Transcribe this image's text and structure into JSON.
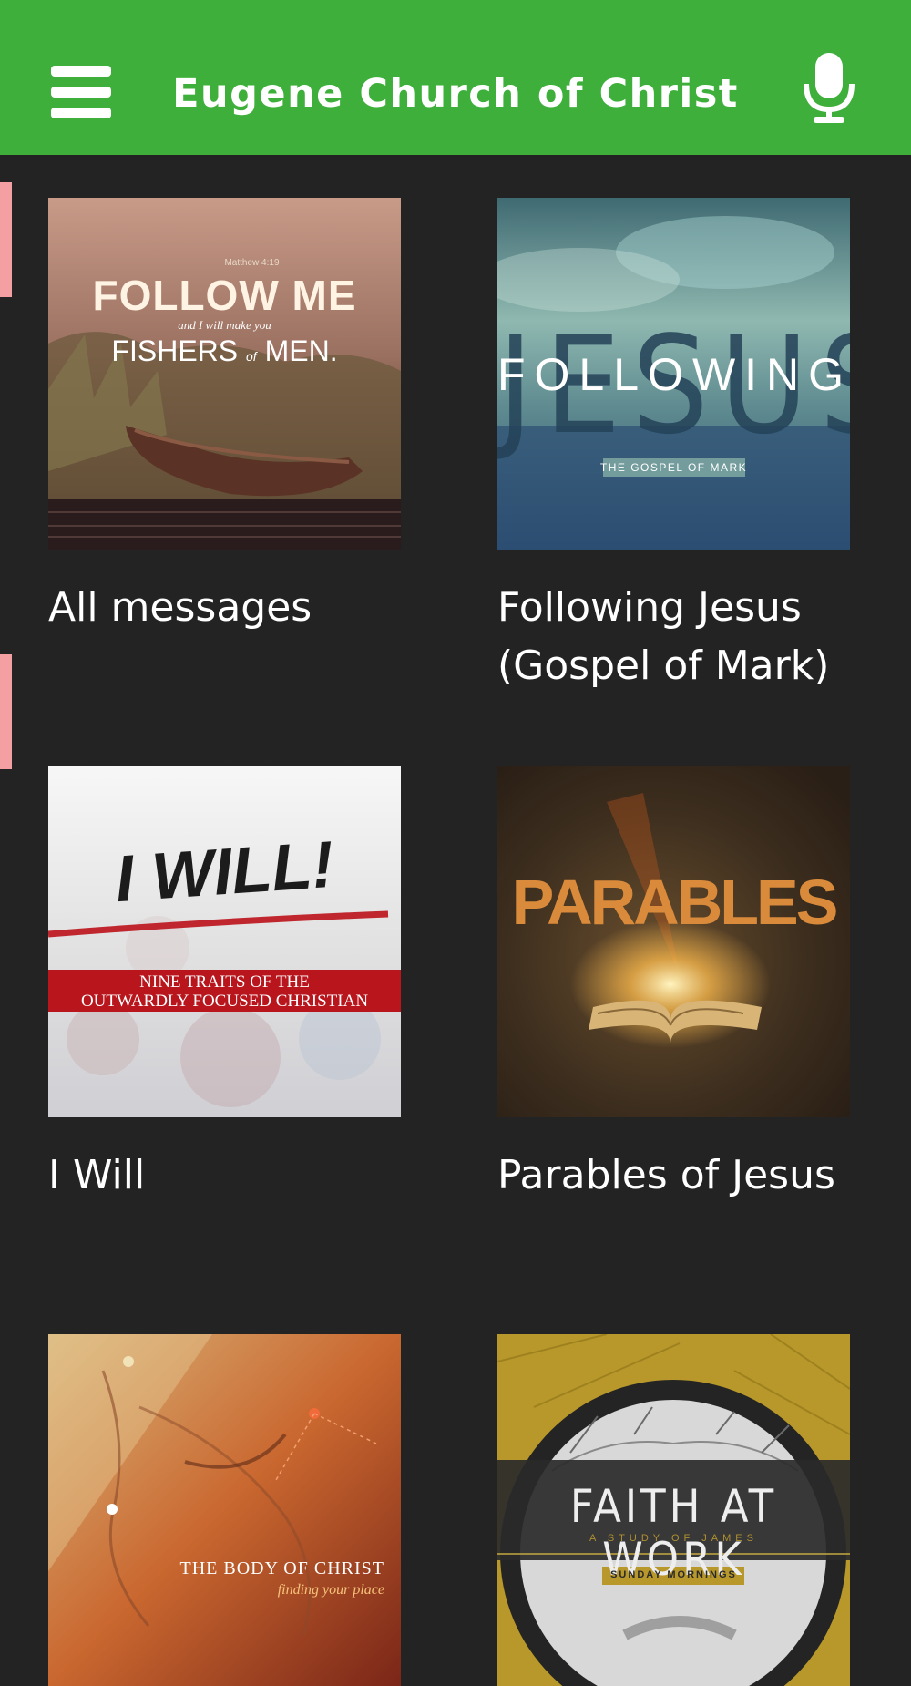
{
  "app": {
    "title": "Eugene Church of Christ",
    "accent_color": "#3daf3a",
    "background_color": "#232323"
  },
  "header": {
    "menu_icon": "hamburger-menu-icon",
    "mic_icon": "microphone-icon"
  },
  "series": [
    {
      "label": "All messages",
      "art": {
        "ref": "Matthew 4:19",
        "headline": "FOLLOW ME",
        "line2": "and I will make you",
        "line3a": "FISHERS",
        "line3b": "of",
        "line3c": "MEN."
      }
    },
    {
      "label": "Following Jesus (Gospel of Mark)",
      "art": {
        "big": "JESUS",
        "overlay": "FOLLOWING",
        "sub": "THE GOSPEL OF MARK"
      }
    },
    {
      "label": "I Will",
      "art": {
        "headline": "I WILL!",
        "band1": "NINE TRAITS OF THE",
        "band2": "OUTWARDLY FOCUSED CHRISTIAN"
      }
    },
    {
      "label": "Parables of Jesus",
      "art": {
        "headline": "PARABLES"
      }
    },
    {
      "label": "",
      "art": {
        "line1": "THE BODY OF CHRIST",
        "line2": "finding your place"
      }
    },
    {
      "label": "",
      "art": {
        "headline": "FAITH AT WORK",
        "sub": "A STUDY OF JAMES",
        "badge": "SUNDAY MORNINGS"
      }
    }
  ]
}
